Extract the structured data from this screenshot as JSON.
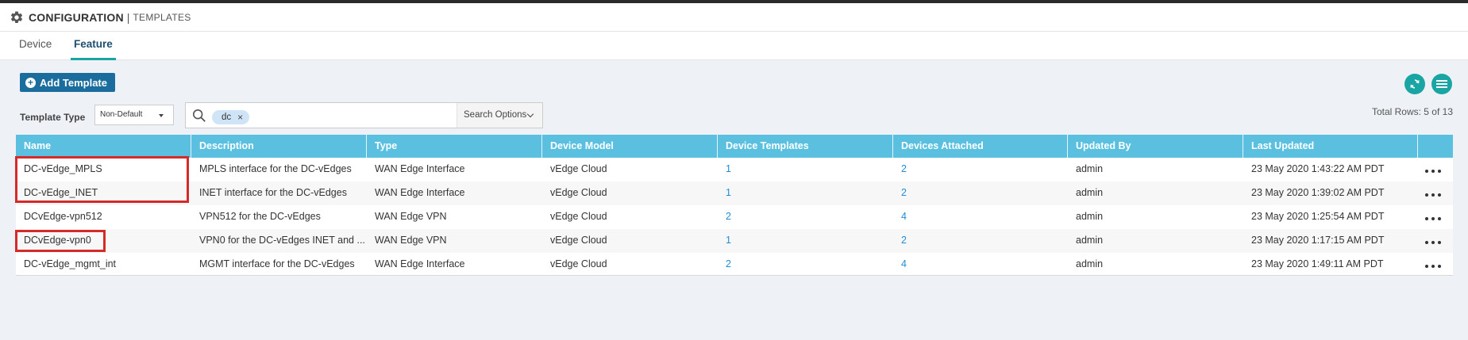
{
  "header": {
    "title": "CONFIGURATION",
    "separator": "|",
    "subtitle": "TEMPLATES",
    "icon": "gear-icon"
  },
  "tabs": [
    {
      "label": "Device",
      "active": false
    },
    {
      "label": "Feature",
      "active": true
    }
  ],
  "toolbar": {
    "add_template_label": "Add Template",
    "template_type_label": "Template Type",
    "template_type_value": "Non-Default",
    "search_chip": "dc",
    "search_chip_remove": "×",
    "search_options_label": "Search Options",
    "total_rows": "Total Rows: 5 of 13",
    "refresh_icon": "refresh-icon",
    "menu_icon": "menu-icon"
  },
  "table": {
    "columns": [
      "Name",
      "Description",
      "Type",
      "Device Model",
      "Device Templates",
      "Devices Attached",
      "Updated By",
      "Last Updated"
    ],
    "rows": [
      [
        "DC-vEdge_MPLS",
        "MPLS interface for the DC-vEdges",
        "WAN Edge Interface",
        "vEdge Cloud",
        "1",
        "2",
        "admin",
        "23 May 2020 1:43:22 AM PDT"
      ],
      [
        "DC-vEdge_INET",
        "INET interface for the DC-vEdges",
        "WAN Edge Interface",
        "vEdge Cloud",
        "1",
        "2",
        "admin",
        "23 May 2020 1:39:02 AM PDT"
      ],
      [
        "DCvEdge-vpn512",
        "VPN512 for the DC-vEdges",
        "WAN Edge VPN",
        "vEdge Cloud",
        "2",
        "4",
        "admin",
        "23 May 2020 1:25:54 AM PDT"
      ],
      [
        "DCvEdge-vpn0",
        "VPN0 for the DC-vEdges INET and ...",
        "WAN Edge VPN",
        "vEdge Cloud",
        "1",
        "2",
        "admin",
        "23 May 2020 1:17:15 AM PDT"
      ],
      [
        "DC-vEdge_mgmt_int",
        "MGMT interface for the DC-vEdges",
        "WAN Edge Interface",
        "vEdge Cloud",
        "2",
        "4",
        "admin",
        "23 May 2020 1:49:11 AM PDT"
      ]
    ]
  },
  "colors": {
    "header_row": "#5bc0e0",
    "accent": "#1aa5a5",
    "button": "#1b6d9e",
    "link": "#1f8dd6",
    "highlight": "#d42a2a"
  }
}
